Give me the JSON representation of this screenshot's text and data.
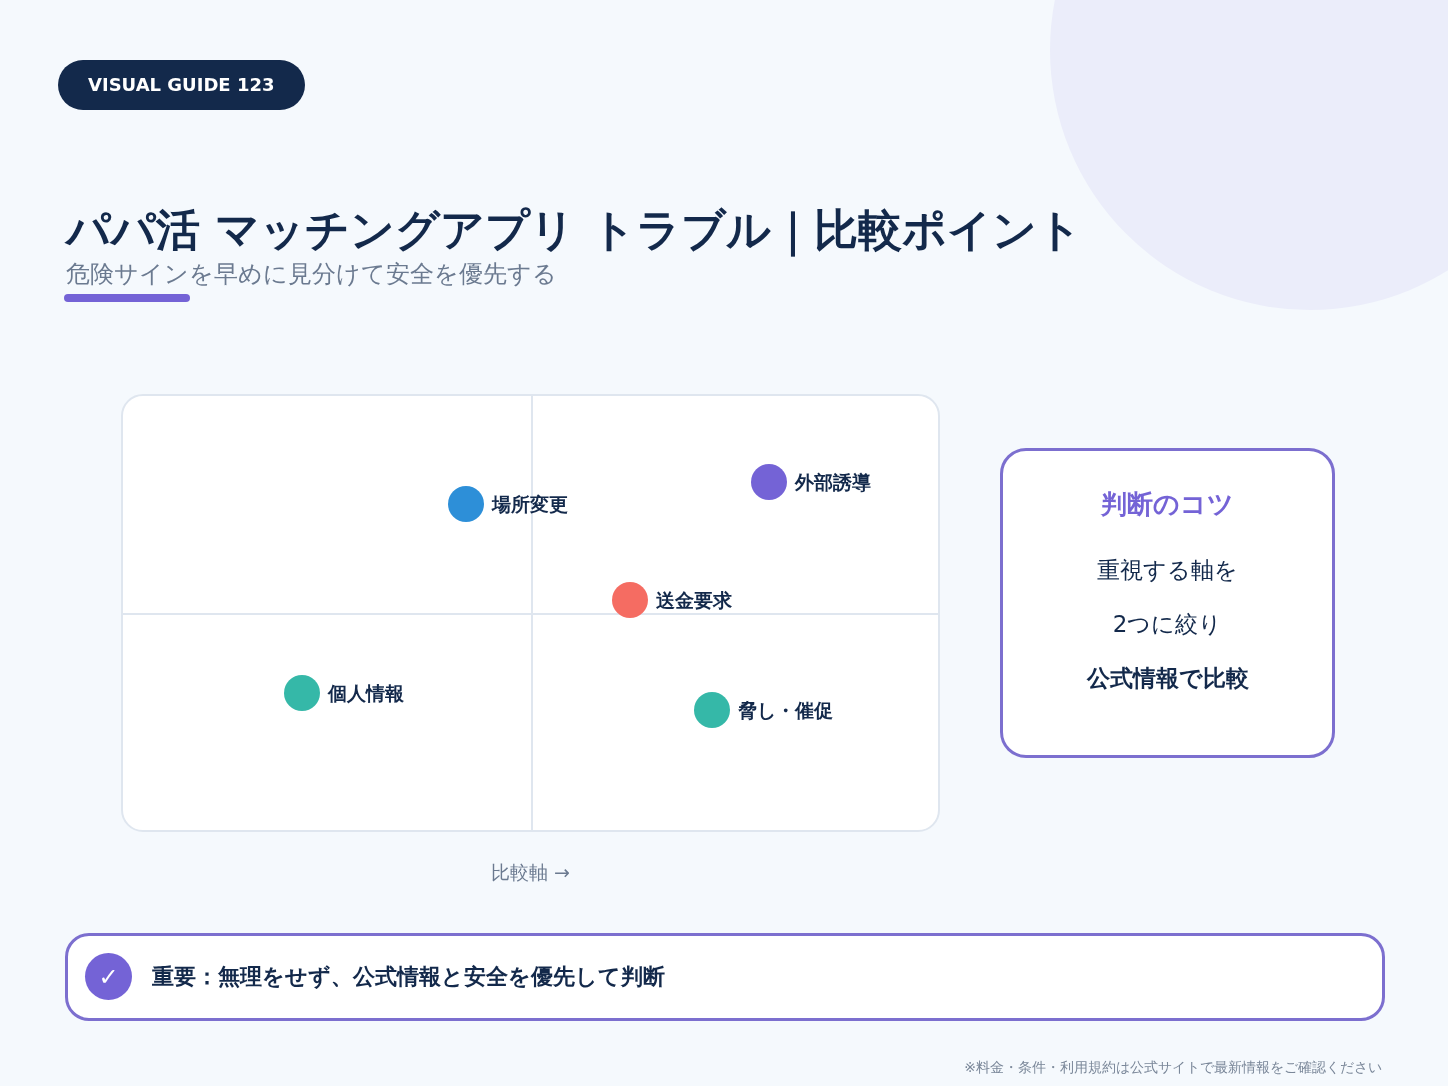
{
  "badge": "VISUAL GUIDE 123",
  "title": "パパ活 マッチングアプリ トラブル｜比較ポイント",
  "subtitle": "危険サインを早めに見分けて安全を優先する",
  "matrix": {
    "points": [
      {
        "label": "場所変更",
        "color": "#2d8fd8"
      },
      {
        "label": "外部誘導",
        "color": "#7463d6"
      },
      {
        "label": "送金要求",
        "color": "#f56c62"
      },
      {
        "label": "個人情報",
        "color": "#35b8a8"
      },
      {
        "label": "脅し・催促",
        "color": "#35b8a8"
      }
    ],
    "axis_label": "比較軸 →"
  },
  "tips": {
    "title": "判断のコツ",
    "lines": [
      {
        "text": "重視する軸を",
        "bold": false
      },
      {
        "text": "2つに絞り",
        "bold": false
      },
      {
        "text": "公式情報で比較",
        "bold": true
      }
    ]
  },
  "notice": {
    "icon": "✓",
    "text": "重要：無理をせず、公式情報と安全を優先して判断"
  },
  "footnote": "※料金・条件・利用規約は公式サイトで最新情報をご確認ください"
}
